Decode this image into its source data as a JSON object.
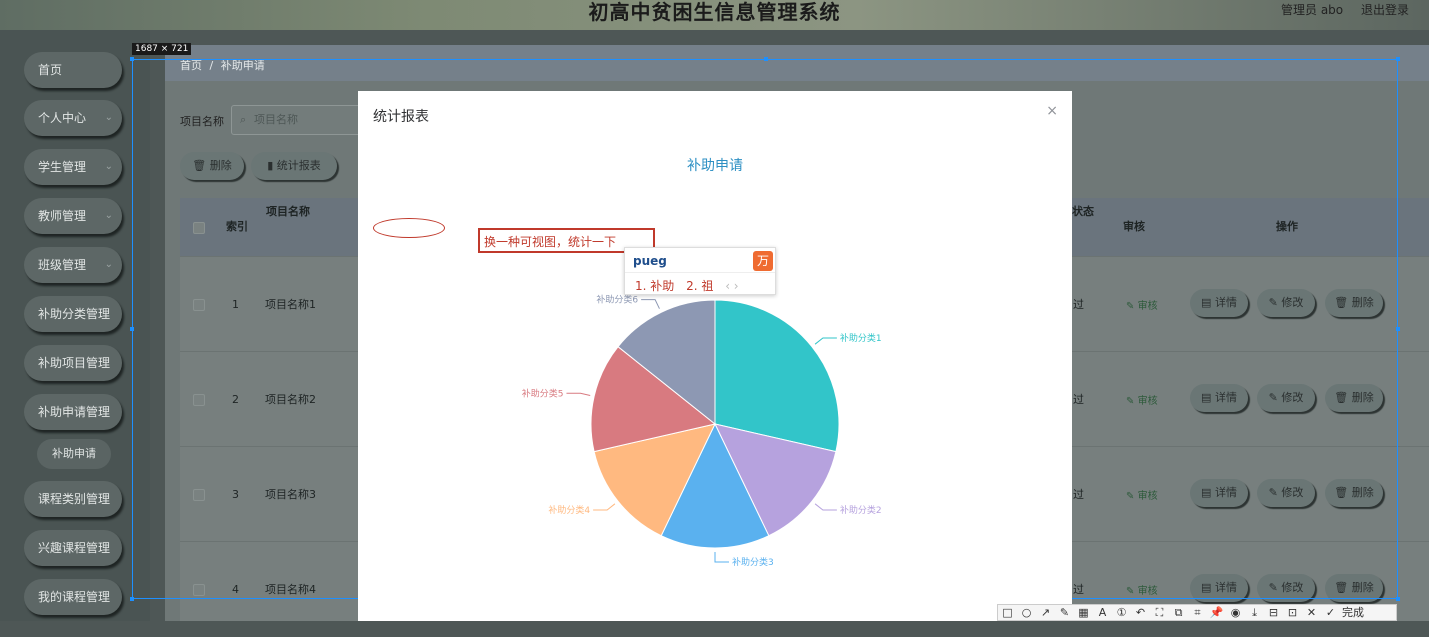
{
  "header": {
    "title": "初高中贫困生信息管理系统",
    "user": "管理员 abo",
    "logout": "退出登录"
  },
  "sidebar": {
    "items": [
      {
        "label": "首页",
        "chevron": false
      },
      {
        "label": "个人中心",
        "chevron": true
      },
      {
        "label": "学生管理",
        "chevron": true
      },
      {
        "label": "教师管理",
        "chevron": true
      },
      {
        "label": "班级管理",
        "chevron": true
      },
      {
        "label": "补助分类管理",
        "chevron": false
      },
      {
        "label": "补助项目管理",
        "chevron": false
      },
      {
        "label": "补助申请管理",
        "chevron": false
      },
      {
        "label": "课程类别管理",
        "chevron": false
      },
      {
        "label": "兴趣课程管理",
        "chevron": false
      },
      {
        "label": "我的课程管理",
        "chevron": false
      }
    ],
    "sub_item": "补助申请"
  },
  "breadcrumb": {
    "home": "首页",
    "sep": "/",
    "current": "补助申请"
  },
  "filter": {
    "label": "项目名称",
    "placeholder": "项目名称",
    "search_icon": "⌕"
  },
  "actions": {
    "delete": "删除",
    "stats": "统计报表"
  },
  "table": {
    "headers": {
      "index": "索引",
      "name": "项目名称",
      "status": "核状态",
      "audit": "审核",
      "ops": "操作"
    },
    "rows": [
      {
        "index": "1",
        "name": "项目名称1",
        "status": "过",
        "audit": "审核"
      },
      {
        "index": "2",
        "name": "项目名称2",
        "status": "过",
        "audit": "审核"
      },
      {
        "index": "3",
        "name": "项目名称3",
        "status": "过",
        "audit": "审核"
      },
      {
        "index": "4",
        "name": "项目名称4",
        "status": "过",
        "audit": "审核"
      }
    ],
    "buttons": {
      "detail": "详情",
      "edit": "修改",
      "delete": "删除"
    }
  },
  "capture": {
    "size_label": "1687 × 721"
  },
  "modal": {
    "title": "统计报表",
    "close": "×"
  },
  "annotation": {
    "text": "换一种可视图，统计一下"
  },
  "ime": {
    "input": "pueg",
    "candidates": [
      "1. 补助",
      "2. 祖"
    ],
    "nav": "‹ ›",
    "logo": "万"
  },
  "toolbar": {
    "icons": [
      "□",
      "○",
      "↗",
      "✎",
      "▦",
      "A",
      "①",
      "↶",
      "⛶",
      "⧉",
      "⌗",
      "📌",
      "◉",
      "⤓",
      "⊟",
      "⊡",
      "✕",
      "✓"
    ],
    "done": "完成"
  },
  "chart_data": {
    "type": "pie",
    "title": "补助申请",
    "categories": [
      "补助分类1",
      "补助分类2",
      "补助分类3",
      "补助分类4",
      "补助分类5",
      "补助分类6"
    ],
    "values": [
      4,
      2,
      2,
      2,
      2,
      2
    ],
    "colors": [
      "#32c5c9",
      "#b6a2de",
      "#5ab1ef",
      "#ffb980",
      "#d87a80",
      "#8d98b3"
    ]
  }
}
